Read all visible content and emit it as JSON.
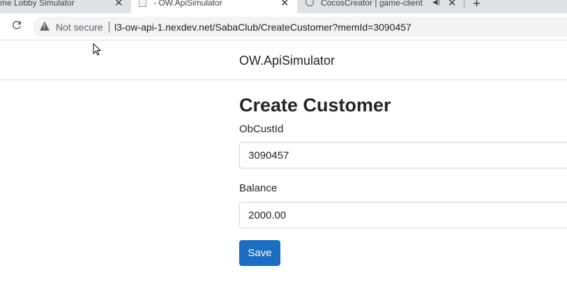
{
  "browser": {
    "tabs": [
      {
        "title": "me Lobby Simulator",
        "close": "✕"
      },
      {
        "title": "- OW.ApiSimulator",
        "close": "✕"
      },
      {
        "title": "CocosCreator | game-client",
        "close": "✕"
      }
    ],
    "new_tab": "+",
    "security_label": "Not secure",
    "url": "l3-ow-api-1.nexdev.net/SabaClub/CreateCustomer?memId=3090457"
  },
  "navbar": {
    "brand": "OW.ApiSimulator"
  },
  "form": {
    "title": "Create Customer",
    "fields": [
      {
        "label": "ObCustId",
        "value": "3090457"
      },
      {
        "label": "Balance",
        "value": "2000.00"
      }
    ],
    "save_label": "Save"
  },
  "colors": {
    "primary": "#1b6ec2",
    "tabstrip": "#dee1e6",
    "omnibox": "#f1f3f4"
  },
  "icons": [
    "reload-icon",
    "warning-icon",
    "audio-icon",
    "close-icon",
    "favicon-icon",
    "cursor-icon"
  ]
}
